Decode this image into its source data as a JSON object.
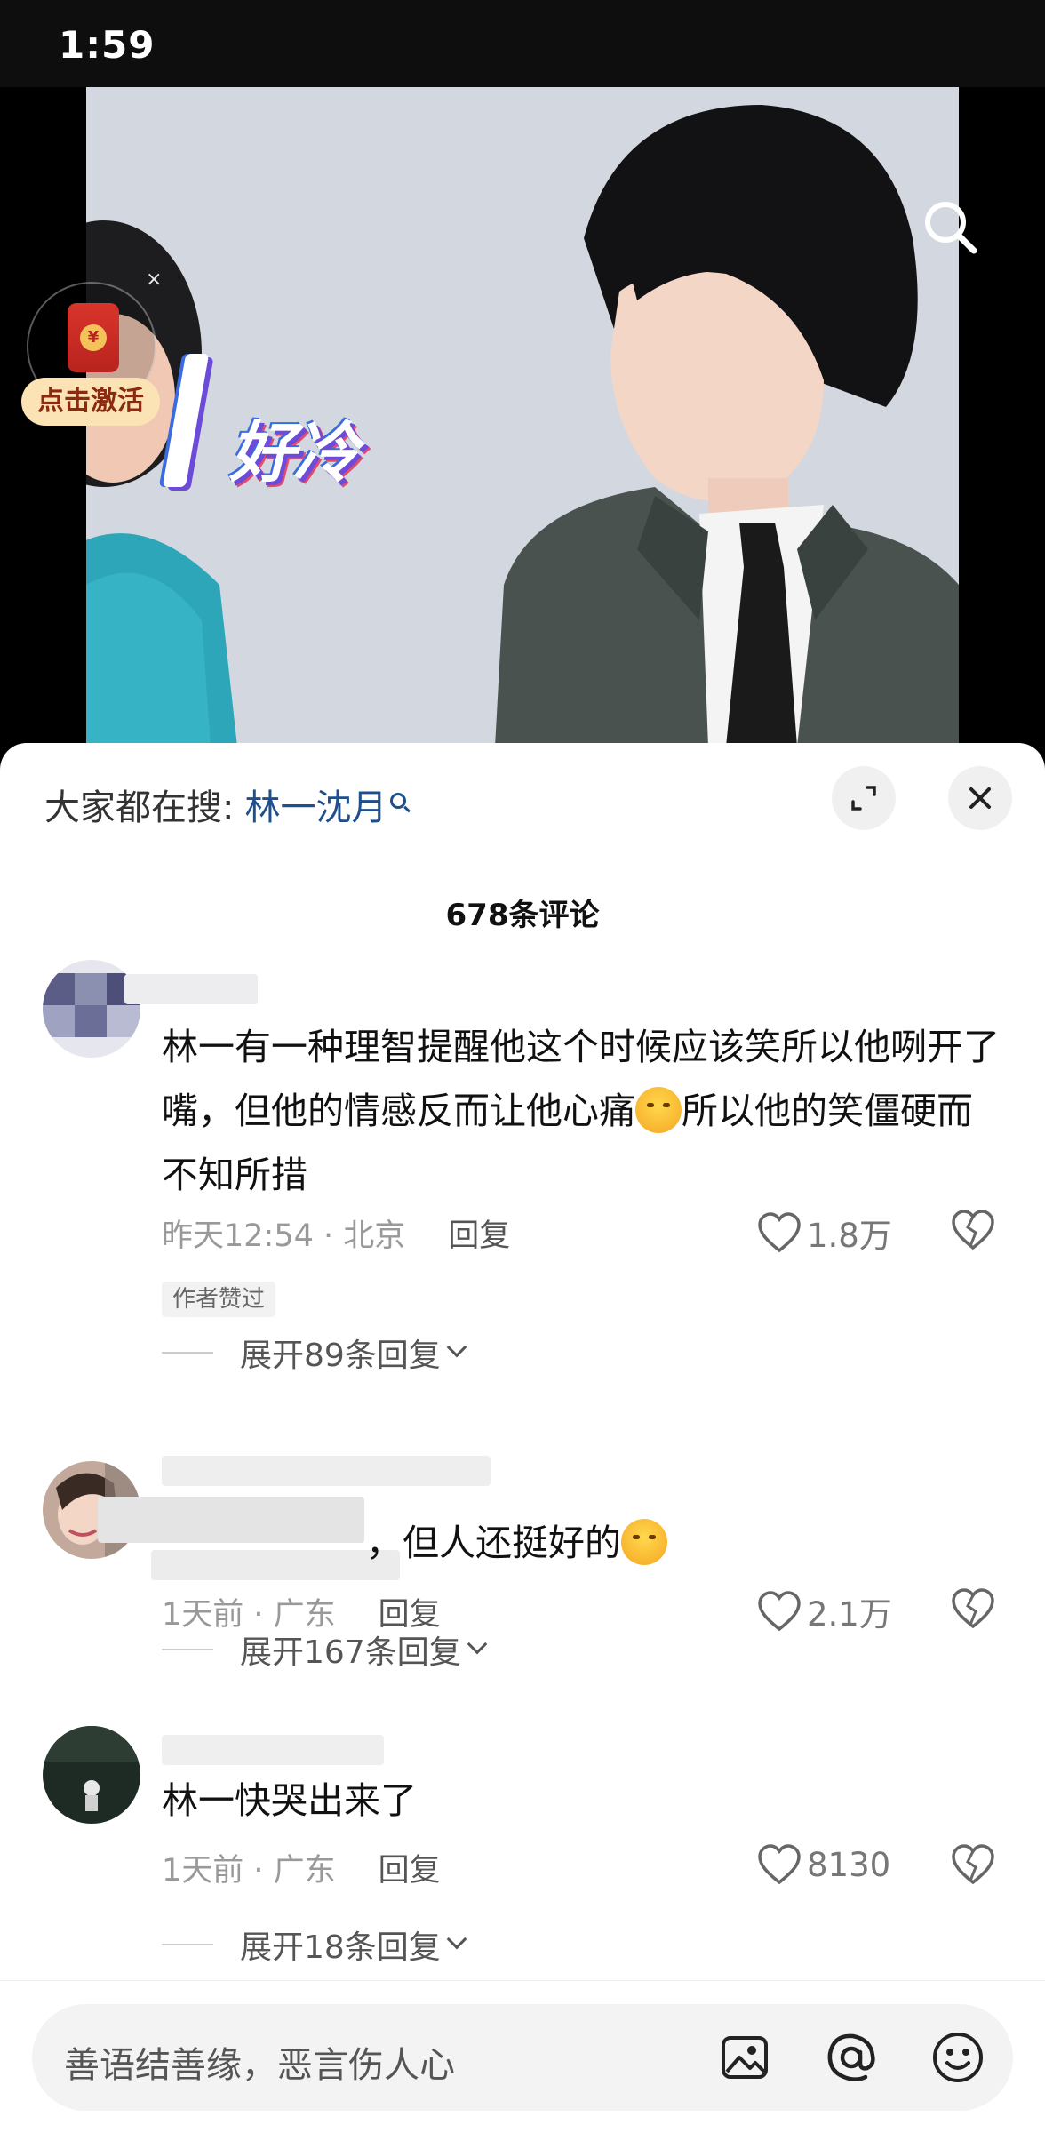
{
  "status_bar": {
    "time": "1:59"
  },
  "video": {
    "caption": "好冷",
    "redpack_label": "点击激活",
    "redpack_close": "×",
    "redpack_coin": "¥"
  },
  "panel": {
    "search_hint_prefix": "大家都在搜:",
    "search_keyword": "林一沈月",
    "comment_count": "678条评论"
  },
  "comments": [
    {
      "text_part1": "林一有一种理智提醒他这个时候应该笑所以他咧开了嘴，但他的情感反而让他心痛",
      "text_part2": "所以他的笑僵硬而不知所措",
      "time_location": "昨天12:54 · 北京",
      "reply_label": "回复",
      "likes": "1.8万",
      "badge": "作者赞过",
      "expand_replies": "展开89条回复"
    },
    {
      "text_visible": "，但人还挺好的",
      "time_location": "1天前 · 广东",
      "reply_label": "回复",
      "likes": "2.1万",
      "expand_replies": "展开167条回复"
    },
    {
      "text": "林一快哭出来了",
      "time_location": "1天前 · 广东",
      "reply_label": "回复",
      "likes": "8130",
      "expand_replies": "展开18条回复"
    }
  ],
  "input": {
    "placeholder": "善语结善缘，恶言伤人心"
  },
  "colors": {
    "accent_keyword": "#1e4f8a",
    "panel_bg": "#ffffff",
    "meta_gray": "#999999"
  }
}
